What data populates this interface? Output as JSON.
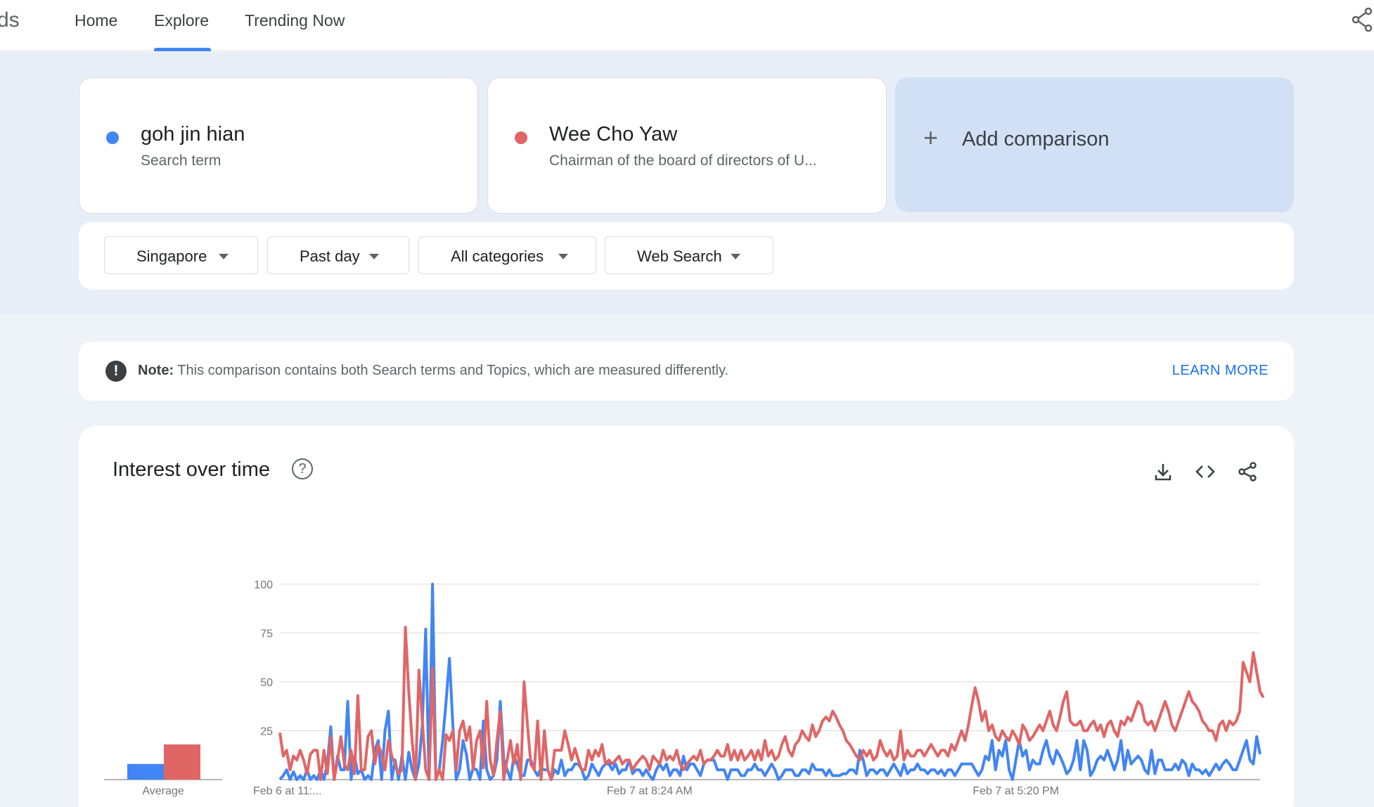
{
  "nav": {
    "logo_fragment": "ds",
    "tabs": [
      {
        "label": "Home"
      },
      {
        "label": "Explore"
      },
      {
        "label": "Trending Now"
      }
    ],
    "active_tab": "Explore"
  },
  "terms": [
    {
      "name": "goh jin hian",
      "subtitle": "Search term",
      "color": "#4285f4"
    },
    {
      "name": "Wee Cho Yaw",
      "subtitle": "Chairman of the board of directors of U...",
      "color": "#e06666"
    }
  ],
  "add_comparison": {
    "label": "Add comparison"
  },
  "filters": [
    {
      "label": "Singapore"
    },
    {
      "label": "Past day"
    },
    {
      "label": "All categories"
    },
    {
      "label": "Web Search"
    }
  ],
  "note": {
    "bold": "Note:",
    "text": " This comparison contains both Search terms and Topics, which are measured differently.",
    "link": "LEARN MORE"
  },
  "chart_panel": {
    "title": "Interest over time",
    "icons": [
      "help-icon",
      "download-icon",
      "embed-code-icon",
      "share-icon"
    ]
  },
  "chart_data": {
    "type": "line",
    "ylim": [
      0,
      100
    ],
    "yticks": [
      25,
      50,
      75,
      100
    ],
    "xtick_labels": [
      "Feb 6 at 11:...",
      "Feb 7 at 8:24 AM",
      "Feb 7 at 5:20 PM"
    ],
    "average_label": "Average",
    "averages": {
      "goh jin hian": 8,
      "Wee Cho Yaw": 18
    },
    "series": [
      {
        "name": "goh jin hian",
        "color": "#4285f4",
        "values": [
          0,
          2,
          5,
          0,
          4,
          0,
          2,
          0,
          5,
          0,
          2,
          0,
          5,
          0,
          8,
          27,
          0,
          12,
          5,
          5,
          40,
          0,
          12,
          3,
          5,
          0,
          2,
          0,
          15,
          20,
          0,
          25,
          35,
          0,
          10,
          0,
          12,
          0,
          14,
          5,
          0,
          8,
          28,
          77,
          0,
          100,
          0,
          5,
          20,
          40,
          62,
          28,
          0,
          5,
          20,
          13,
          0,
          6,
          5,
          0,
          30,
          5,
          0,
          2,
          10,
          40,
          10,
          5,
          0,
          12,
          8,
          2,
          2,
          10,
          10,
          5,
          2,
          6,
          5,
          5,
          0,
          5,
          3,
          10,
          2,
          5,
          5,
          8,
          8,
          5,
          0,
          2,
          8,
          5,
          2,
          6,
          8,
          8,
          5,
          8,
          3,
          5,
          5,
          10,
          3,
          5,
          5,
          2,
          5,
          2,
          0,
          5,
          8,
          5,
          8,
          2,
          5,
          5,
          2,
          12,
          5,
          8,
          8,
          5,
          2,
          8,
          10,
          10,
          10,
          5,
          5,
          5,
          0,
          5,
          5,
          5,
          2,
          2,
          5,
          5,
          8,
          5,
          5,
          2,
          5,
          8,
          5,
          0,
          2,
          5,
          5,
          5,
          2,
          2,
          5,
          5,
          3,
          8,
          5,
          5,
          5,
          2,
          5,
          2,
          2,
          2,
          3,
          3,
          5,
          5,
          3,
          15,
          10,
          2,
          5,
          5,
          3,
          5,
          5,
          2,
          5,
          8,
          5,
          2,
          8,
          3,
          5,
          5,
          8,
          5,
          5,
          3,
          5,
          5,
          3,
          5,
          2,
          5,
          5,
          2,
          5,
          8,
          8,
          8,
          8,
          5,
          2,
          5,
          12,
          10,
          20,
          5,
          15,
          12,
          20,
          5,
          0,
          10,
          20,
          12,
          15,
          5,
          10,
          8,
          8,
          15,
          20,
          12,
          8,
          15,
          12,
          8,
          3,
          5,
          10,
          20,
          5,
          20,
          15,
          2,
          5,
          10,
          12,
          10,
          15,
          10,
          5,
          10,
          20,
          5,
          15,
          8,
          10,
          12,
          10,
          5,
          3,
          15,
          3,
          10,
          10,
          5,
          5,
          5,
          8,
          5,
          10,
          8,
          2,
          8,
          5,
          5,
          3,
          5,
          2,
          5,
          8,
          5,
          8,
          10,
          8,
          5,
          5,
          10,
          15,
          20,
          10,
          8,
          22,
          13
        ]
      },
      {
        "name": "Wee Cho Yaw",
        "color": "#e06666",
        "values": [
          24,
          12,
          15,
          5,
          12,
          10,
          15,
          10,
          3,
          13,
          15,
          15,
          0,
          15,
          3,
          22,
          0,
          10,
          22,
          8,
          5,
          15,
          3,
          43,
          5,
          5,
          22,
          25,
          8,
          18,
          13,
          5,
          20,
          12,
          8,
          3,
          5,
          78,
          45,
          20,
          0,
          56,
          30,
          5,
          0,
          57,
          0,
          5,
          0,
          23,
          20,
          25,
          5,
          25,
          30,
          20,
          27,
          5,
          20,
          25,
          6,
          40,
          10,
          2,
          20,
          35,
          0,
          10,
          20,
          8,
          18,
          0,
          50,
          28,
          8,
          5,
          30,
          0,
          25,
          5,
          0,
          15,
          15,
          15,
          25,
          18,
          10,
          16,
          10,
          5,
          5,
          15,
          10,
          15,
          12,
          18,
          8,
          10,
          8,
          10,
          12,
          8,
          10,
          10,
          5,
          8,
          10,
          12,
          10,
          5,
          12,
          10,
          8,
          15,
          10,
          12,
          10,
          15,
          8,
          5,
          8,
          10,
          12,
          10,
          15,
          8,
          10,
          10,
          12,
          15,
          12,
          12,
          18,
          10,
          15,
          10,
          15,
          10,
          12,
          15,
          10,
          15,
          10,
          20,
          12,
          15,
          10,
          12,
          18,
          22,
          15,
          12,
          18,
          20,
          25,
          22,
          20,
          28,
          22,
          25,
          30,
          32,
          30,
          35,
          32,
          28,
          25,
          20,
          18,
          15,
          12,
          10,
          15,
          12,
          15,
          10,
          12,
          20,
          15,
          12,
          15,
          10,
          12,
          25,
          10,
          15,
          12,
          12,
          15,
          15,
          12,
          15,
          18,
          15,
          12,
          15,
          15,
          12,
          18,
          15,
          20,
          25,
          20,
          28,
          38,
          47,
          40,
          30,
          35,
          25,
          28,
          22,
          20,
          25,
          22,
          20,
          25,
          22,
          18,
          28,
          25,
          20,
          22,
          25,
          28,
          25,
          30,
          35,
          28,
          25,
          32,
          40,
          45,
          30,
          28,
          28,
          30,
          25,
          25,
          28,
          30,
          25,
          28,
          22,
          28,
          30,
          25,
          22,
          30,
          28,
          32,
          30,
          35,
          40,
          38,
          30,
          28,
          30,
          25,
          30,
          35,
          40,
          35,
          28,
          25,
          30,
          35,
          40,
          45,
          40,
          38,
          35,
          30,
          28,
          25,
          25,
          20,
          28,
          30,
          25,
          30,
          28,
          30,
          35,
          60,
          55,
          50,
          65,
          55,
          45,
          42
        ]
      }
    ]
  }
}
